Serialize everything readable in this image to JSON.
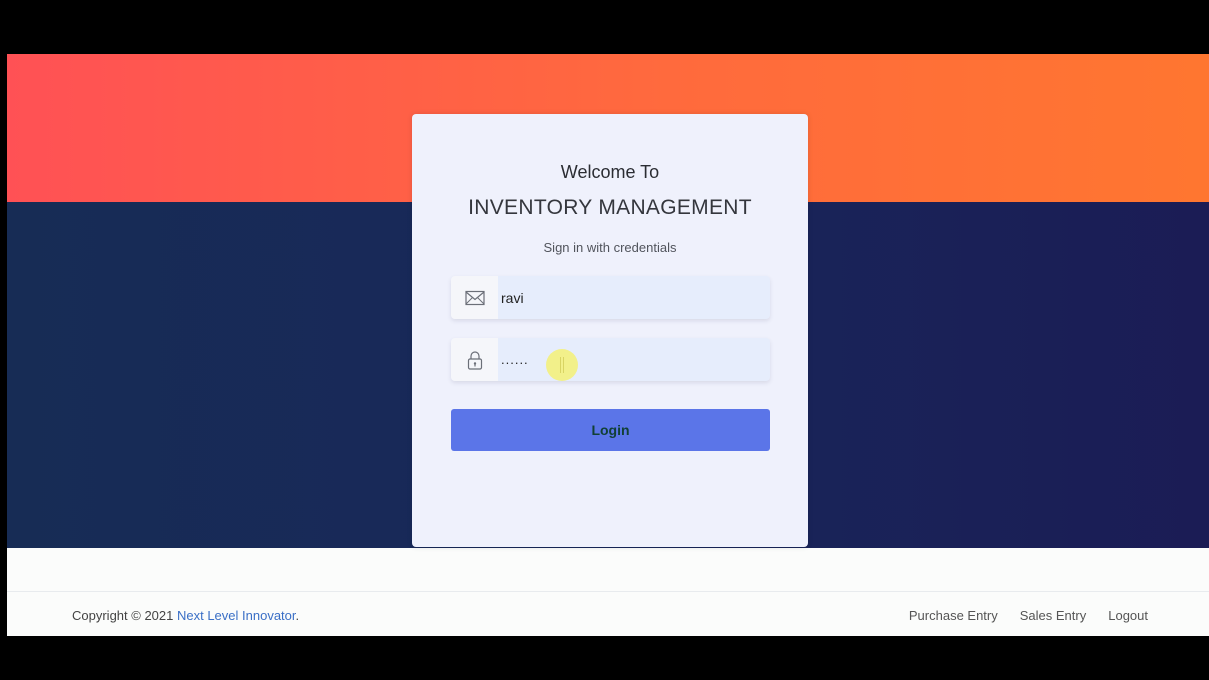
{
  "login_card": {
    "welcome": "Welcome To",
    "app_name": "INVENTORY MANAGEMENT",
    "subtitle": "Sign in with credentials",
    "email": {
      "value": "ravi",
      "icon": "envelope-icon"
    },
    "password": {
      "value": "......",
      "icon": "lock-icon"
    },
    "login_label": "Login"
  },
  "footer": {
    "copyright_prefix": "Copyright © 2021",
    "company": "Next Level Innovator",
    "copyright_suffix": ".",
    "links": [
      "Purchase Entry",
      "Sales Entry",
      "Logout"
    ]
  },
  "colors": {
    "accent": "#5b75e8",
    "hero_top": "#ff5a4a",
    "hero_bottom": "#172c55",
    "link": "#3a6fc6"
  }
}
